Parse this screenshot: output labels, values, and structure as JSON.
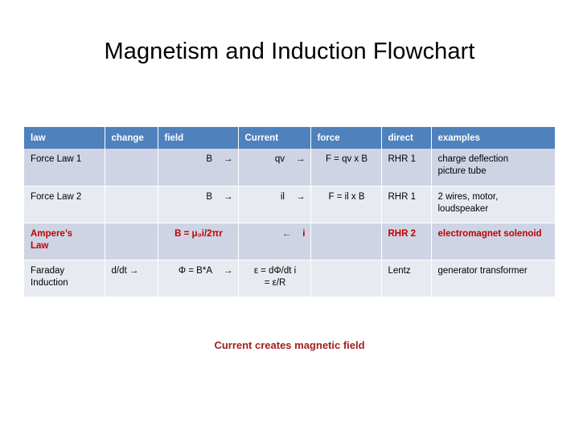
{
  "slide": {
    "title": "Magnetism and Induction Flowchart",
    "caption": "Current creates magnetic field"
  },
  "colors": {
    "header_bg": "#4F81BD",
    "header_text": "#FFFFFF",
    "band_dark": "#CED4E4",
    "band_light": "#E7EBF1",
    "red_text": "#C00000",
    "caption_red": "#A02020",
    "body_text": "#000000",
    "page_bg": "#FFFFFF"
  },
  "table": {
    "headers": [
      "law",
      "change",
      "field",
      "Current",
      "force",
      "direct",
      "examples"
    ],
    "rows": [
      {
        "law": "Force Law 1",
        "change": "",
        "field_symbol": "B",
        "field_arrow": "→",
        "current_symbol": "qv",
        "current_arrow": "→",
        "force": "F = qv x B",
        "direct": "RHR 1",
        "examples_line1": "charge deflection",
        "examples_line2": "picture tube"
      },
      {
        "law": "Force Law 2",
        "change": "",
        "field_symbol": "B",
        "field_arrow": "→",
        "current_symbol": "il",
        "current_arrow": "→",
        "force": "F = il x B",
        "direct": "RHR 1",
        "examples_line1": "2 wires, motor,",
        "examples_line2": "loudspeaker"
      },
      {
        "law_line1": "Ampere’s",
        "law_line2": "Law",
        "change": "",
        "field_symbol": "B = μ₀i/2πr",
        "field_arrow": "",
        "current_symbol": "←",
        "current_arrow": "i",
        "force": "",
        "direct": "RHR 2",
        "examples_line1": "electromagnet solenoid",
        "examples_line2": ""
      },
      {
        "law_line1": "Faraday",
        "law_line2": "Induction",
        "change": "d/dt →",
        "field_symbol": "Φ = B*A",
        "field_arrow": "→",
        "current_line1": "ε = dΦ/dt i",
        "current_line2": "= ε/R",
        "force": "",
        "direct": "Lentz",
        "examples_line1": "generator transformer",
        "examples_line2": ""
      }
    ]
  }
}
